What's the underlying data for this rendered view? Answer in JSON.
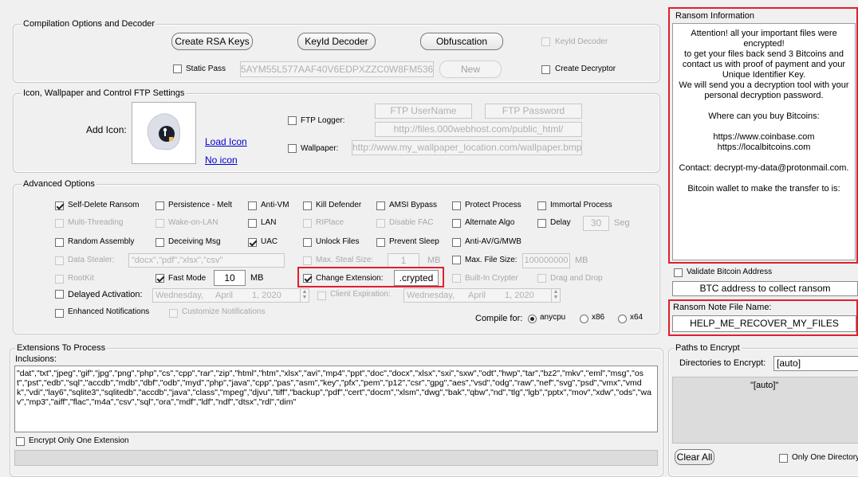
{
  "compilation": {
    "legend": "Compilation Options and Decoder",
    "create_rsa": "Create RSA Keys",
    "keyid_decoder_btn": "KeyId Decoder",
    "obfuscation": "Obfuscation",
    "keyid_decoder_chk": "KeyId Decoder",
    "static_pass": "Static Pass",
    "static_pass_value": "5AYM55L577AAF40V6EDPXZZC0W8FM536",
    "new_btn": "New",
    "create_decryptor": "Create Decryptor"
  },
  "icon_section": {
    "legend": "Icon, Wallpaper and Control FTP Settings",
    "add_icon": "Add Icon:",
    "load_icon": "Load Icon",
    "no_icon": "No icon",
    "ftp_logger": "FTP Logger:",
    "ftp_user": "FTP UserName",
    "ftp_pass": "FTP Password",
    "ftp_url": "http://files.000webhost.com/public_html/",
    "wallpaper": "Wallpaper:",
    "wallpaper_url": "http://www.my_wallpaper_location.com/wallpaper.bmp"
  },
  "advanced": {
    "legend": "Advanced Options",
    "self_delete": "Self-Delete Ransom",
    "persistence": "Persistence - Melt",
    "anti_vm": "Anti-VM",
    "kill_defender": "Kill Defender",
    "amsi_bypass": "AMSI Bypass",
    "protect_process": "Protect Process",
    "immortal_process": "Immortal Process",
    "multi_threading": "Multi-Threading",
    "wake_on_lan": "Wake-on-LAN",
    "lan": "LAN",
    "riplace": "RIPlace",
    "disable_fac": "Disable FAC",
    "alternate_algo": "Alternate Algo",
    "delay": "Delay",
    "delay_value": "30",
    "seg": "Seg",
    "random_assembly": "Random Assembly",
    "deceiving_msg": "Deceiving Msg",
    "uac": "UAC",
    "unlock_files": "Unlock Files",
    "prevent_sleep": "Prevent Sleep",
    "anti_av": "Anti-AV/G/MWB",
    "data_stealer": "Data Stealer:",
    "data_stealer_value": "\"docx\",\"pdf\",\"xlsx\",\"csv\"",
    "max_steal_size": "Max. Steal Size:",
    "max_steal_value": "1",
    "mb1": "MB",
    "max_file_size": "Max. File Size:",
    "max_file_value": "100000000",
    "mb2": "MB",
    "rootkit": "RootKit",
    "fast_mode": "Fast Mode",
    "fast_mode_value": "10",
    "mb3": "MB",
    "change_extension": "Change Extension:",
    "extension_value": ".crypted",
    "builtin_crypter": "Built-In Crypter",
    "drag_drop": "Drag and Drop",
    "delayed_activation": "Delayed Activation:",
    "date1": [
      "Wednesday,",
      "April",
      "1, 2020"
    ],
    "client_expiration": "Client Expiration:",
    "date2": [
      "Wednesday,",
      "April",
      "1, 2020"
    ],
    "enhanced_notifications": "Enhanced Notifications",
    "customize_notifications": "Customize Notifications",
    "compile_for": "Compile for:",
    "anycpu": "anycpu",
    "x86": "x86",
    "x64": "x64"
  },
  "extensions": {
    "legend": "Extensions To Process",
    "inclusions": "Inclusions:",
    "text": "\"dat\",\"txt\",\"jpeg\",\"gif\",\"jpg\",\"png\",\"php\",\"cs\",\"cpp\",\"rar\",\"zip\",\"html\",\"htm\",\"xlsx\",\"avi\",\"mp4\",\"ppt\",\"doc\",\"docx\",\"xlsx\",\"sxi\",\"sxw\",\"odt\",\"hwp\",\"tar\",\"bz2\",\"mkv\",\"eml\",\"msg\",\"ost\",\"pst\",\"edb\",\"sql\",\"accdb\",\"mdb\",\"dbf\",\"odb\",\"myd\",\"php\",\"java\",\"cpp\",\"pas\",\"asm\",\"key\",\"pfx\",\"pem\",\"p12\",\"csr\",\"gpg\",\"aes\",\"vsd\",\"odg\",\"raw\",\"nef\",\"svg\",\"psd\",\"vmx\",\"vmdk\",\"vdi\",\"lay6\",\"sqlite3\",\"sqlitedb\",\"accdb\",\"java\",\"class\",\"mpeg\",\"djvu\",\"tiff\",\"backup\",\"pdf\",\"cert\",\"docm\",\"xlsm\",\"dwg\",\"bak\",\"qbw\",\"nd\",\"tlg\",\"lgb\",\"pptx\",\"mov\",\"xdw\",\"ods\",\"wav\",\"mp3\",\"aiff\",\"flac\",\"m4a\",\"csv\",\"sql\",\"ora\",\"mdf\",\"ldf\",\"ndf\",\"dtsx\",\"rdl\",\"dim\"",
    "encrypt_one": "Encrypt Only One Extension"
  },
  "ransom": {
    "legend": "Ransom Information",
    "lines": [
      "Attention! all your important files were encrypted!",
      "to get your files back send 3 Bitcoins and",
      "contact us with proof of payment and your",
      "Unique Identifier Key.",
      "We will send you a decryption tool with your",
      "personal decryption password.",
      "",
      "Where can you buy Bitcoins:",
      "",
      "https://www.coinbase.com",
      "https://localbitcoins.com",
      "",
      "Contact: decrypt-my-data@protonmail.com.",
      "",
      "Bitcoin wallet to make the transfer to is:"
    ],
    "validate_btc": "Validate Bitcoin Address",
    "btc_address": "BTC address to collect ransom",
    "note_label": "Ransom Note File Name:",
    "note_value": "HELP_ME_RECOVER_MY_FILES"
  },
  "paths": {
    "legend": "Paths to Encrypt",
    "dirs_label": "Directories to Encrypt:",
    "dirs_value": "[auto]",
    "list_item": "\"[auto]\"",
    "clear_all": "Clear All",
    "only_one_dir": "Only One Directory"
  },
  "colors": {
    "highlight": "#e0202c",
    "link": "#0000cc"
  }
}
